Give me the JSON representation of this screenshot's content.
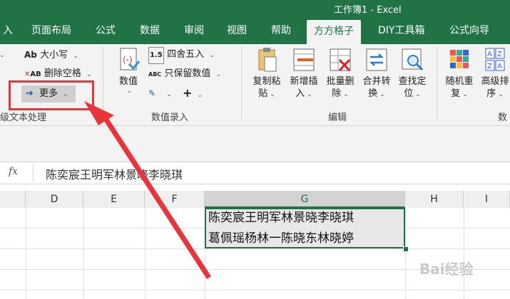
{
  "window": {
    "title": "工作簿1  -  Excel"
  },
  "tabs": [
    {
      "label": "入"
    },
    {
      "label": "页面布局"
    },
    {
      "label": "公式"
    },
    {
      "label": "数据"
    },
    {
      "label": "审阅"
    },
    {
      "label": "视图"
    },
    {
      "label": "帮助"
    },
    {
      "label": "方方格子",
      "active": true
    },
    {
      "label": "DIY工具箱"
    },
    {
      "label": "公式向导"
    }
  ],
  "ribbon": {
    "text_group": {
      "case_icon": "Ab",
      "case_label": "大小写",
      "delete_space_label": "删除空格",
      "more_label": "更多",
      "group_label": "级文本处理"
    },
    "number_group": {
      "value_label": "数值",
      "round_label": "四舍五入",
      "keep_value_label": "只保留数值",
      "keep_icon": "ABC",
      "plus_label": "+",
      "group_label": "数值录入"
    },
    "edit_group": {
      "buttons": [
        {
          "line1": "复制粘",
          "line2": "贴"
        },
        {
          "line1": "新增插",
          "line2": "入"
        },
        {
          "line1": "批量删",
          "line2": "除"
        },
        {
          "line1": "合并转",
          "line2": "换"
        },
        {
          "line1": "查找定",
          "line2": "位"
        }
      ],
      "group_label": "编辑"
    },
    "data_group": {
      "buttons": [
        {
          "line1": "随机重",
          "line2": "复"
        },
        {
          "line1": "高级排",
          "line2": "序"
        }
      ],
      "group_label": "数"
    }
  },
  "formula_bar": {
    "fx_label": "fx",
    "content": "陈奕宸王明军林景晓李晓琪"
  },
  "columns": [
    "D",
    "E",
    "F",
    "G",
    "H",
    "I"
  ],
  "selected_column": "G",
  "cells": {
    "G1": "陈奕宸王明军林景晓李晓琪",
    "G2": "葛佩瑶杨林一陈晓东林晓婷"
  },
  "watermark": "Bai经验",
  "colors": {
    "excel_green": "#217346",
    "highlight_red": "#e8343b"
  },
  "icons": [
    "dropdown-caret-icon",
    "arrow-right-icon",
    "number-value-icon",
    "paste-icon",
    "insert-icon",
    "batch-delete-icon",
    "merge-convert-icon",
    "find-locate-icon",
    "random-repeat-icon",
    "sort-icon",
    "fx-icon"
  ]
}
